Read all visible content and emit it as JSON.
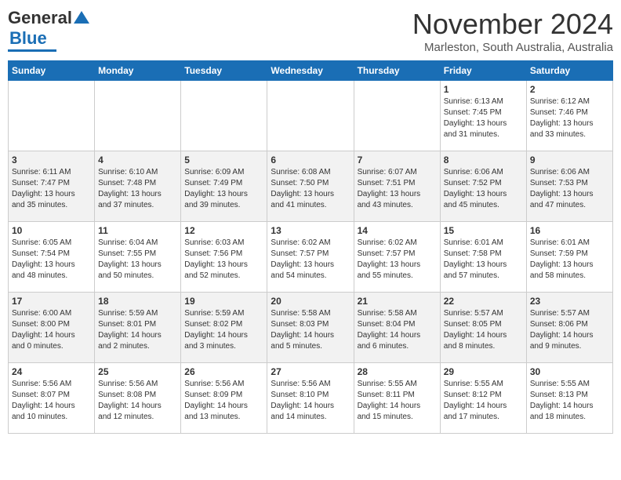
{
  "header": {
    "logo_line1": "General",
    "logo_line2": "Blue",
    "month_title": "November 2024",
    "location": "Marleston, South Australia, Australia"
  },
  "days_of_week": [
    "Sunday",
    "Monday",
    "Tuesday",
    "Wednesday",
    "Thursday",
    "Friday",
    "Saturday"
  ],
  "weeks": [
    [
      {
        "day": "",
        "info": ""
      },
      {
        "day": "",
        "info": ""
      },
      {
        "day": "",
        "info": ""
      },
      {
        "day": "",
        "info": ""
      },
      {
        "day": "",
        "info": ""
      },
      {
        "day": "1",
        "info": "Sunrise: 6:13 AM\nSunset: 7:45 PM\nDaylight: 13 hours\nand 31 minutes."
      },
      {
        "day": "2",
        "info": "Sunrise: 6:12 AM\nSunset: 7:46 PM\nDaylight: 13 hours\nand 33 minutes."
      }
    ],
    [
      {
        "day": "3",
        "info": "Sunrise: 6:11 AM\nSunset: 7:47 PM\nDaylight: 13 hours\nand 35 minutes."
      },
      {
        "day": "4",
        "info": "Sunrise: 6:10 AM\nSunset: 7:48 PM\nDaylight: 13 hours\nand 37 minutes."
      },
      {
        "day": "5",
        "info": "Sunrise: 6:09 AM\nSunset: 7:49 PM\nDaylight: 13 hours\nand 39 minutes."
      },
      {
        "day": "6",
        "info": "Sunrise: 6:08 AM\nSunset: 7:50 PM\nDaylight: 13 hours\nand 41 minutes."
      },
      {
        "day": "7",
        "info": "Sunrise: 6:07 AM\nSunset: 7:51 PM\nDaylight: 13 hours\nand 43 minutes."
      },
      {
        "day": "8",
        "info": "Sunrise: 6:06 AM\nSunset: 7:52 PM\nDaylight: 13 hours\nand 45 minutes."
      },
      {
        "day": "9",
        "info": "Sunrise: 6:06 AM\nSunset: 7:53 PM\nDaylight: 13 hours\nand 47 minutes."
      }
    ],
    [
      {
        "day": "10",
        "info": "Sunrise: 6:05 AM\nSunset: 7:54 PM\nDaylight: 13 hours\nand 48 minutes."
      },
      {
        "day": "11",
        "info": "Sunrise: 6:04 AM\nSunset: 7:55 PM\nDaylight: 13 hours\nand 50 minutes."
      },
      {
        "day": "12",
        "info": "Sunrise: 6:03 AM\nSunset: 7:56 PM\nDaylight: 13 hours\nand 52 minutes."
      },
      {
        "day": "13",
        "info": "Sunrise: 6:02 AM\nSunset: 7:57 PM\nDaylight: 13 hours\nand 54 minutes."
      },
      {
        "day": "14",
        "info": "Sunrise: 6:02 AM\nSunset: 7:57 PM\nDaylight: 13 hours\nand 55 minutes."
      },
      {
        "day": "15",
        "info": "Sunrise: 6:01 AM\nSunset: 7:58 PM\nDaylight: 13 hours\nand 57 minutes."
      },
      {
        "day": "16",
        "info": "Sunrise: 6:01 AM\nSunset: 7:59 PM\nDaylight: 13 hours\nand 58 minutes."
      }
    ],
    [
      {
        "day": "17",
        "info": "Sunrise: 6:00 AM\nSunset: 8:00 PM\nDaylight: 14 hours\nand 0 minutes."
      },
      {
        "day": "18",
        "info": "Sunrise: 5:59 AM\nSunset: 8:01 PM\nDaylight: 14 hours\nand 2 minutes."
      },
      {
        "day": "19",
        "info": "Sunrise: 5:59 AM\nSunset: 8:02 PM\nDaylight: 14 hours\nand 3 minutes."
      },
      {
        "day": "20",
        "info": "Sunrise: 5:58 AM\nSunset: 8:03 PM\nDaylight: 14 hours\nand 5 minutes."
      },
      {
        "day": "21",
        "info": "Sunrise: 5:58 AM\nSunset: 8:04 PM\nDaylight: 14 hours\nand 6 minutes."
      },
      {
        "day": "22",
        "info": "Sunrise: 5:57 AM\nSunset: 8:05 PM\nDaylight: 14 hours\nand 8 minutes."
      },
      {
        "day": "23",
        "info": "Sunrise: 5:57 AM\nSunset: 8:06 PM\nDaylight: 14 hours\nand 9 minutes."
      }
    ],
    [
      {
        "day": "24",
        "info": "Sunrise: 5:56 AM\nSunset: 8:07 PM\nDaylight: 14 hours\nand 10 minutes."
      },
      {
        "day": "25",
        "info": "Sunrise: 5:56 AM\nSunset: 8:08 PM\nDaylight: 14 hours\nand 12 minutes."
      },
      {
        "day": "26",
        "info": "Sunrise: 5:56 AM\nSunset: 8:09 PM\nDaylight: 14 hours\nand 13 minutes."
      },
      {
        "day": "27",
        "info": "Sunrise: 5:56 AM\nSunset: 8:10 PM\nDaylight: 14 hours\nand 14 minutes."
      },
      {
        "day": "28",
        "info": "Sunrise: 5:55 AM\nSunset: 8:11 PM\nDaylight: 14 hours\nand 15 minutes."
      },
      {
        "day": "29",
        "info": "Sunrise: 5:55 AM\nSunset: 8:12 PM\nDaylight: 14 hours\nand 17 minutes."
      },
      {
        "day": "30",
        "info": "Sunrise: 5:55 AM\nSunset: 8:13 PM\nDaylight: 14 hours\nand 18 minutes."
      }
    ]
  ]
}
